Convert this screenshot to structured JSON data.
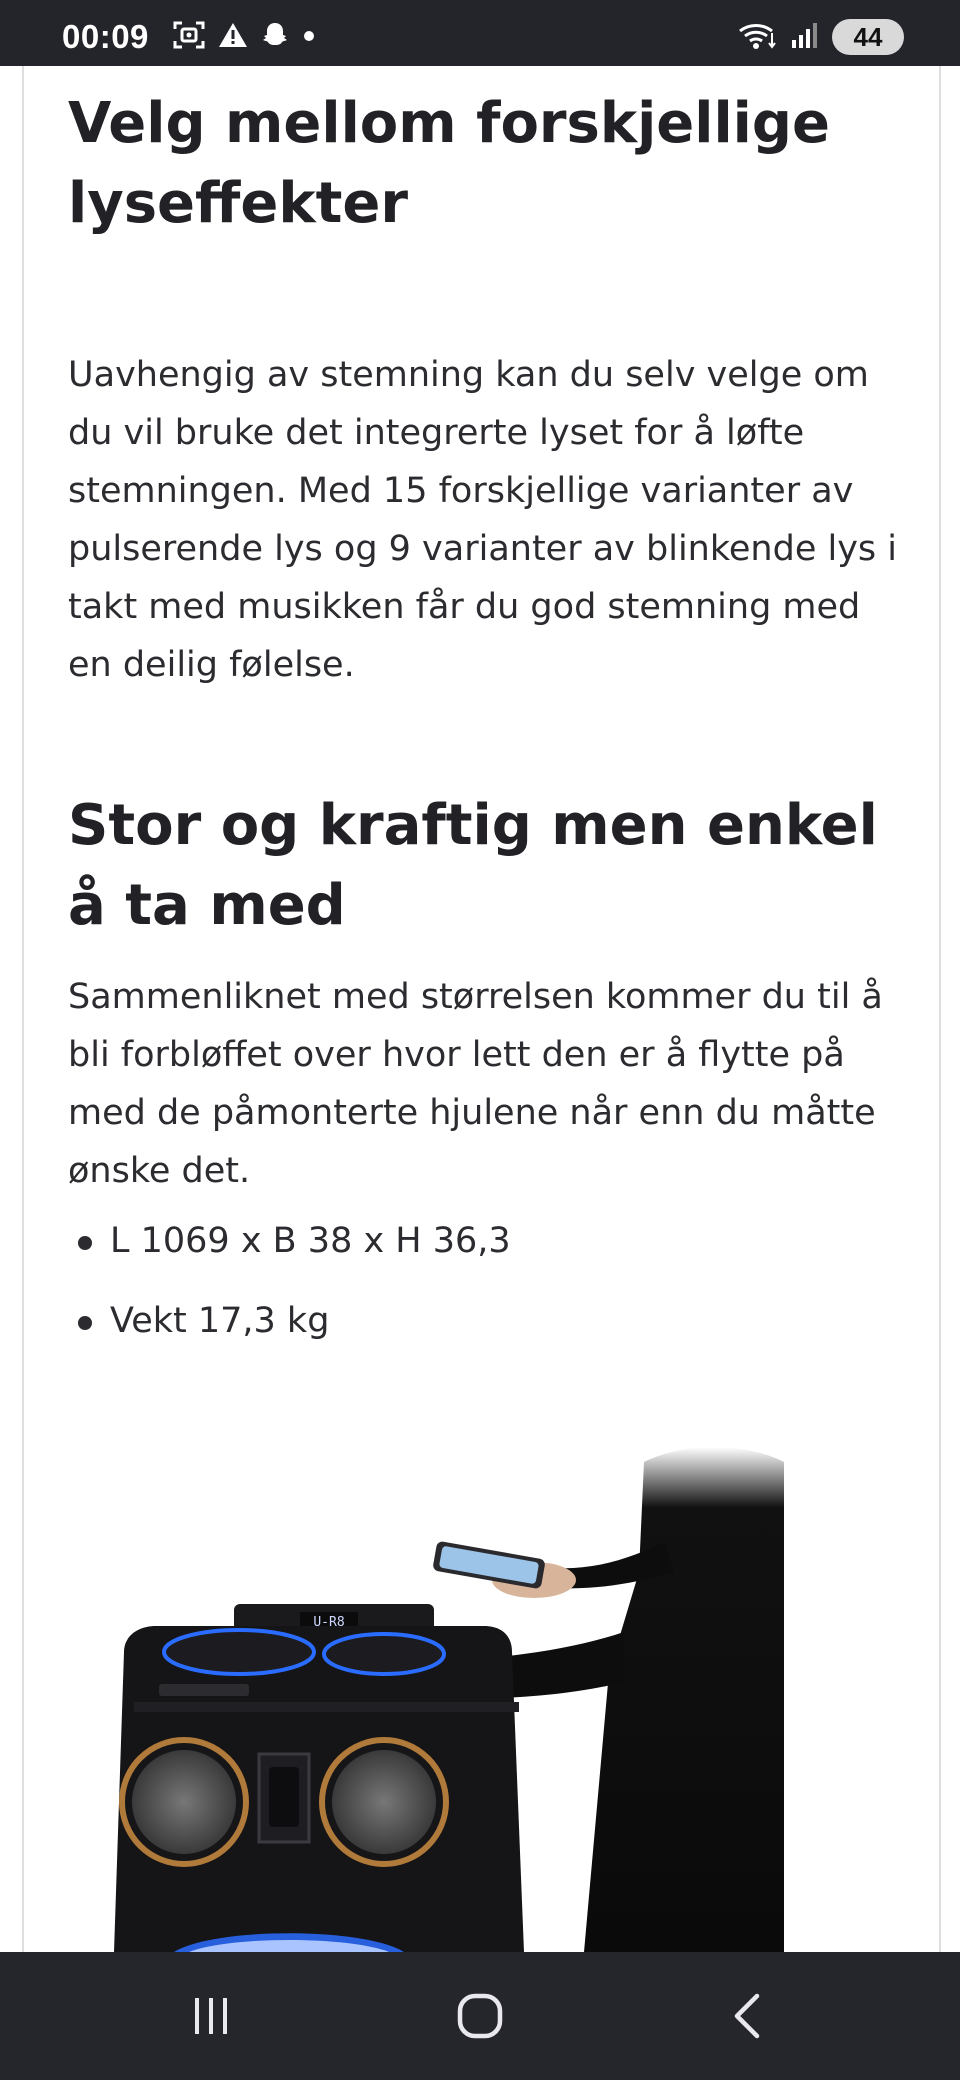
{
  "status_bar": {
    "time": "00:09",
    "left_icons": [
      "screenshot-icon",
      "warning-icon",
      "snapchat-icon",
      "dot-icon"
    ],
    "right_icons": [
      "wifi-icon",
      "signal-icon"
    ],
    "battery": "44"
  },
  "article": {
    "heading_1": "Velg mellom forskjellige lyseffekter",
    "paragraph_1": "Uavhengig av stemning kan du selv velge om du vil bruke det integrerte lyset for å løfte stemningen. Med 15 forskjellige varianter av pulserende lys og 9 varianter av blinkende lys i takt med musikken får du god stemning med en deilig følelse.",
    "heading_2": "Stor og kraftig men enkel å ta med",
    "paragraph_2": "Sammenliknet med størrelsen kommer du til å bli forbløffet over hvor lett den er å flytte på med de påmonterte hjulene når enn du måtte ønske det.",
    "bullets": [
      "L 1069 x B 38 x H 36,3",
      "Vekt 17,3 kg"
    ],
    "speaker_display": "U-R8"
  },
  "nav_bar": {
    "buttons": [
      "recent-apps-icon",
      "home-icon",
      "back-icon"
    ]
  },
  "colors": {
    "status_bar_bg": "#24252b",
    "nav_bar_bg": "#25262c",
    "text": "#222226",
    "speaker_ring": "#b07a3a",
    "speaker_blue_light": "#2a6cff"
  }
}
